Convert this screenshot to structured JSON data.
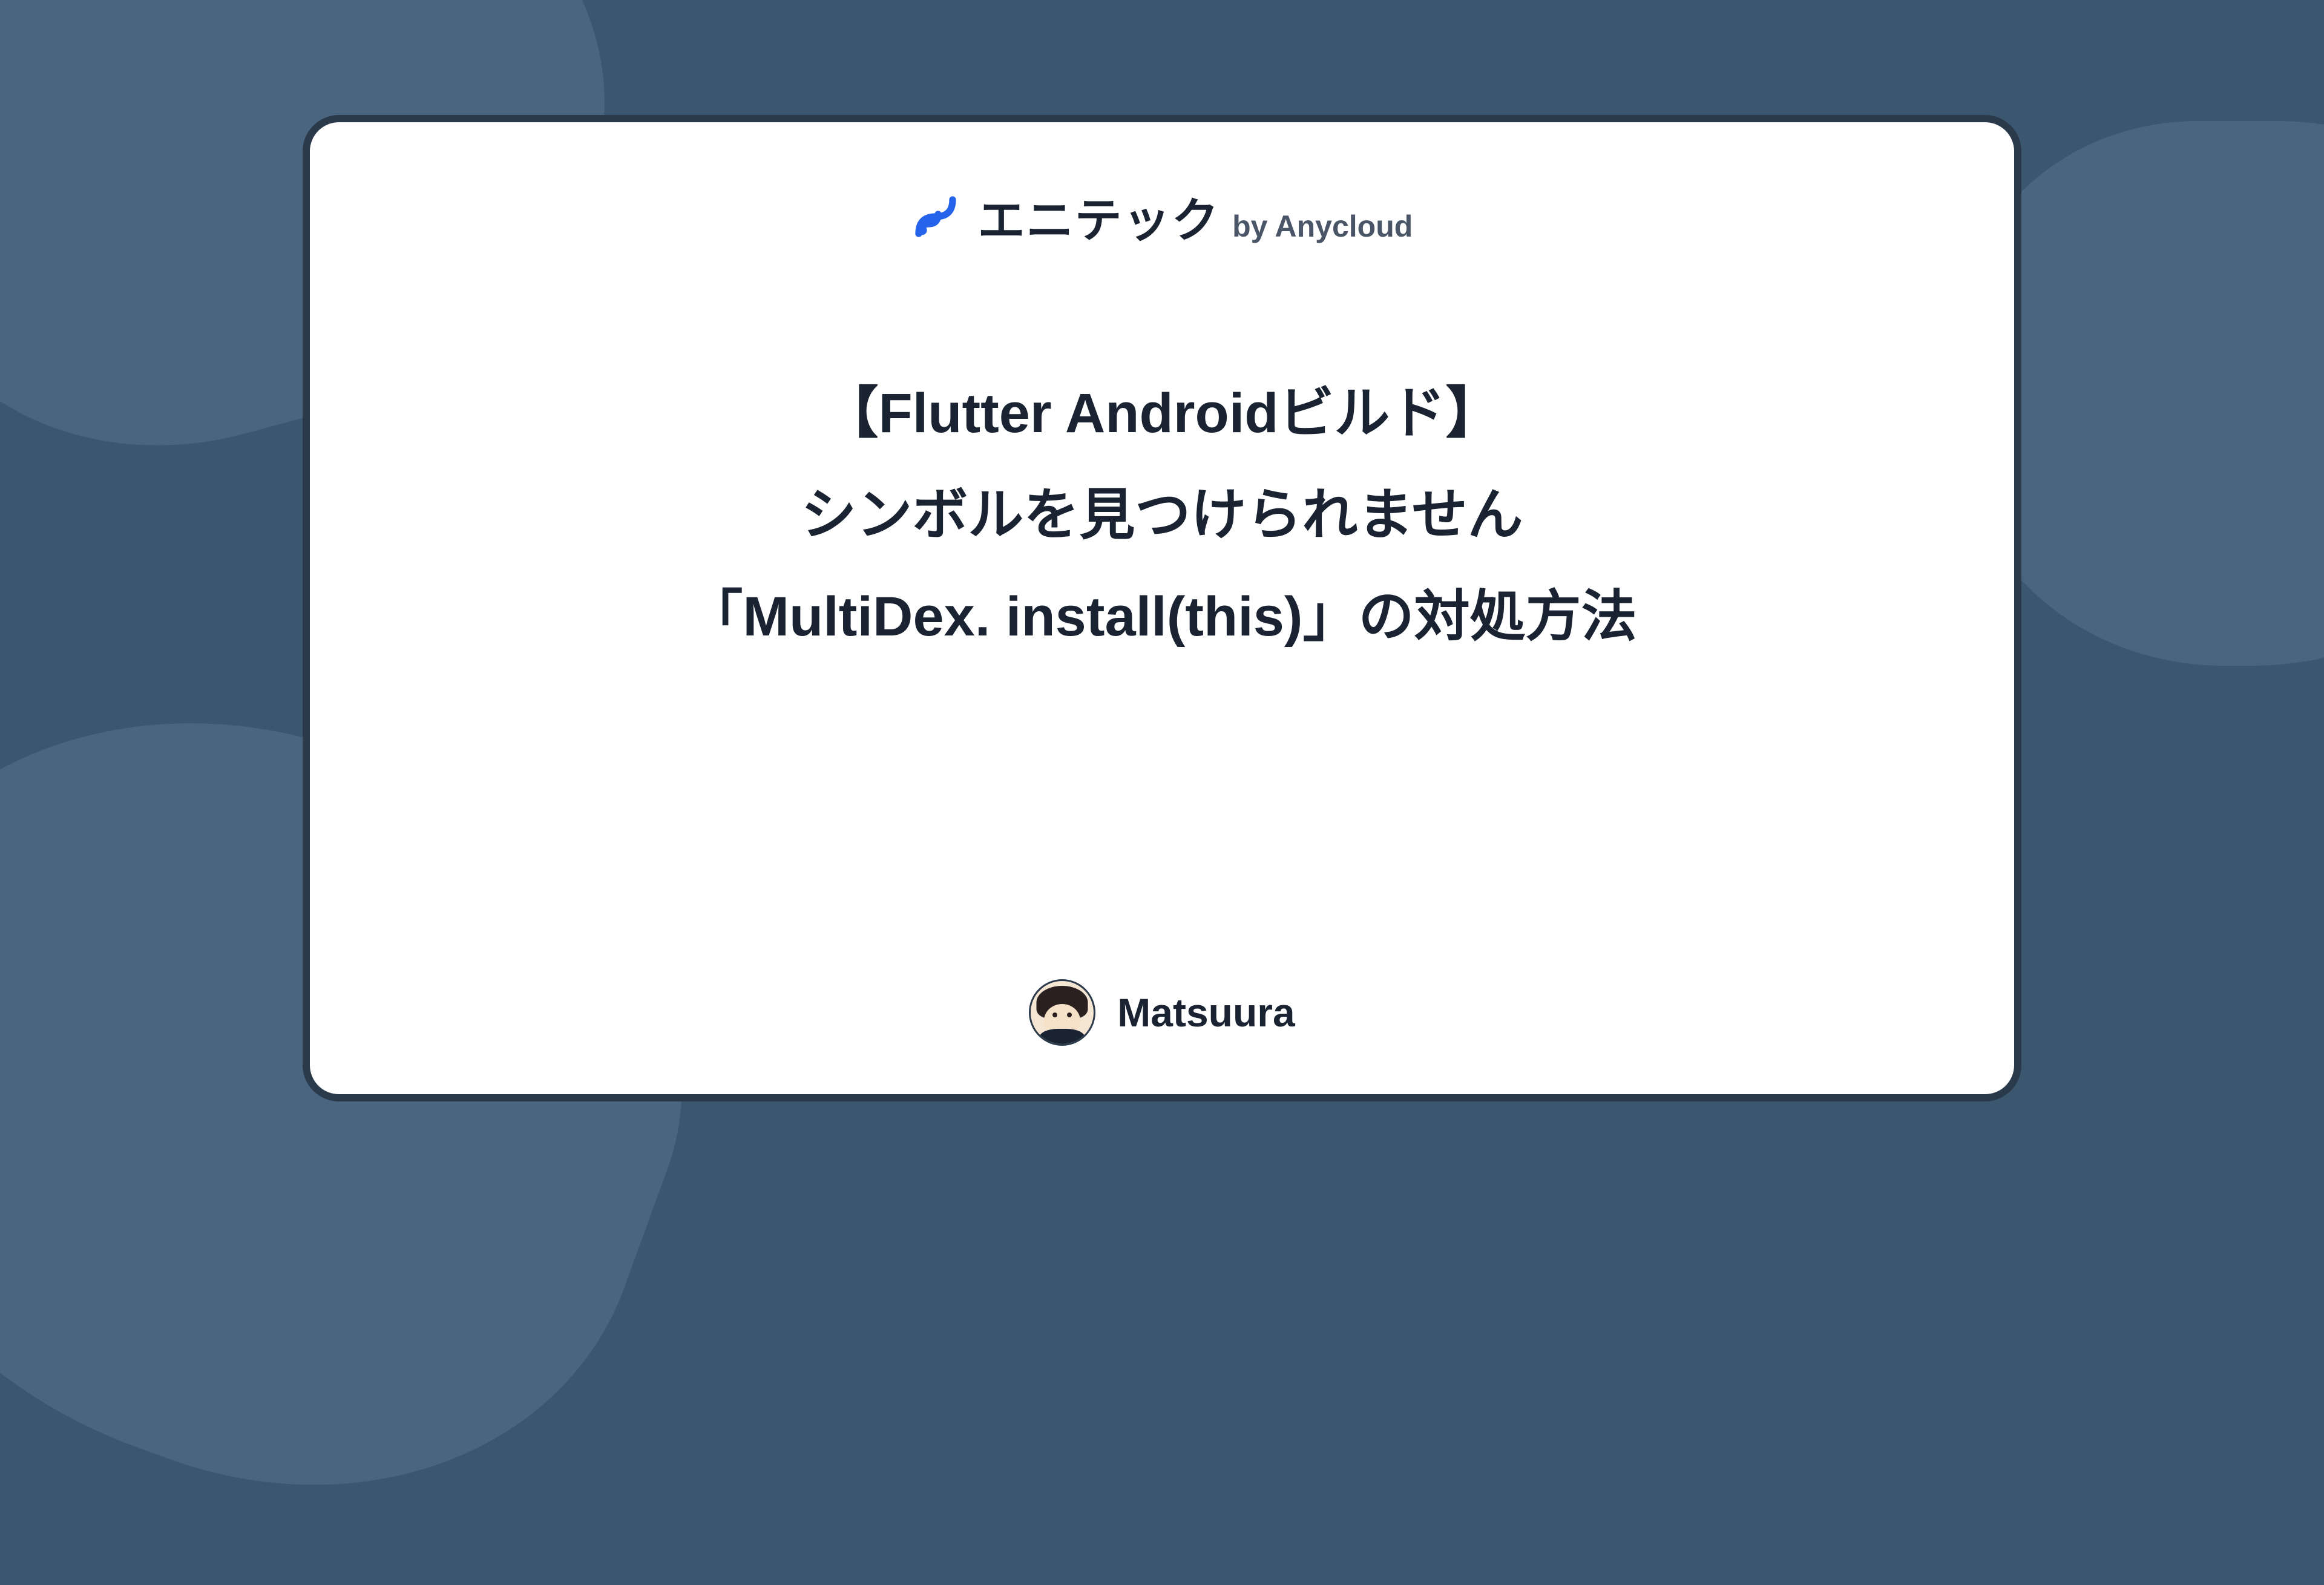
{
  "logo": {
    "brand_text": "エニテック",
    "suffix": "by Anycloud"
  },
  "article": {
    "title_line_1": "【Flutter Androidビルド】",
    "title_line_2": "シンボルを見つけられません",
    "title_line_3": "「MultiDex. install(this)」の対処方法"
  },
  "author": {
    "name": "Matsuura"
  }
}
